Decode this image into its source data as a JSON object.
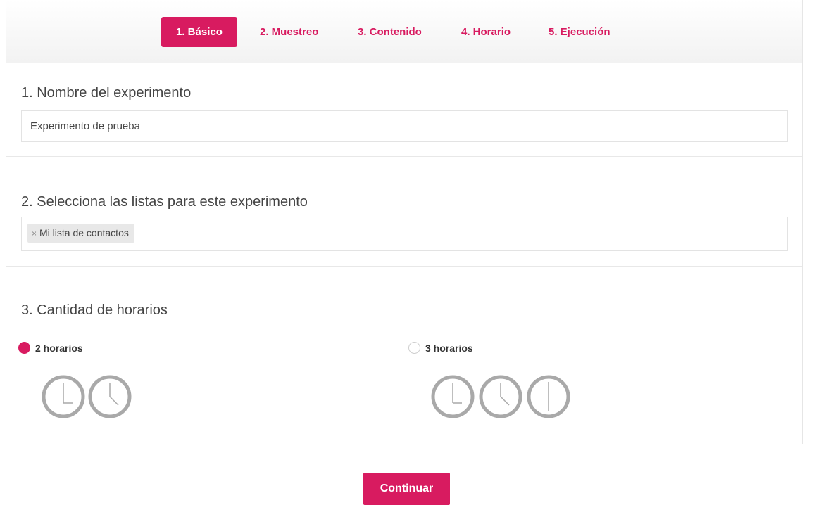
{
  "tabs": [
    {
      "label": "1. Básico",
      "active": true
    },
    {
      "label": "2. Muestreo",
      "active": false
    },
    {
      "label": "3. Contenido",
      "active": false
    },
    {
      "label": "4. Horario",
      "active": false
    },
    {
      "label": "5. Ejecución",
      "active": false
    }
  ],
  "name_section": {
    "title": "1. Nombre del experimento",
    "input_value": "Experimento de prueba"
  },
  "lists_section": {
    "title": "2. Selecciona las listas para este experimento",
    "tag_remove": "×",
    "tags": [
      "Mi lista de contactos"
    ]
  },
  "schedules_section": {
    "title": "3. Cantidad de horarios",
    "options": [
      {
        "label": "2 horarios",
        "selected": true,
        "clocks": 2
      },
      {
        "label": "3 horarios",
        "selected": false,
        "clocks": 3
      }
    ]
  },
  "continue_label": "Continuar",
  "colors": {
    "accent": "#d81b60",
    "clock": "#a9a9a9"
  }
}
